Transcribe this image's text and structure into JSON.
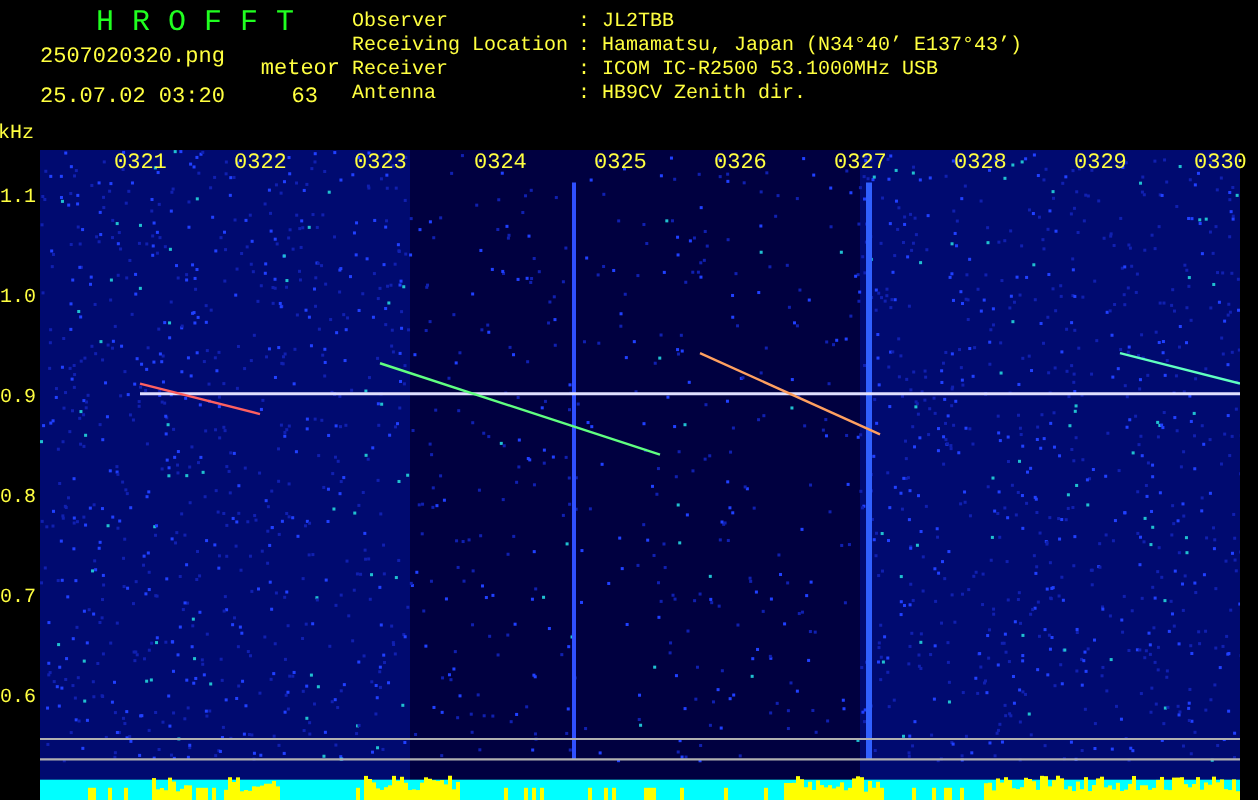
{
  "header": {
    "title": "H R O F F T",
    "file_name": "2507020320.png",
    "timestamp": "25.07.02 03:20",
    "mode": "meteor",
    "count": "63"
  },
  "info": [
    {
      "label": "Observer",
      "separator": ":",
      "value": "JL2TBB"
    },
    {
      "label": "Receiving Location",
      "separator": ":",
      "value": "Hamamatsu, Japan (N34°40’ E137°43’)"
    },
    {
      "label": "Receiver",
      "separator": ":",
      "value": "ICOM IC-R2500 53.1000MHz USB"
    },
    {
      "label": "Antenna",
      "separator": ":",
      "value": "HB9CV Zenith dir."
    }
  ],
  "spectrogram": {
    "freq_unit": "kHz",
    "freq_labels": [
      "1.1",
      "1.0",
      "0.9",
      "0.8",
      "0.7",
      "0.6"
    ],
    "time_labels": [
      "0321",
      "0322",
      "0323",
      "0324",
      "0325",
      "0326",
      "0327",
      "0328",
      "0329",
      "0330"
    ]
  }
}
